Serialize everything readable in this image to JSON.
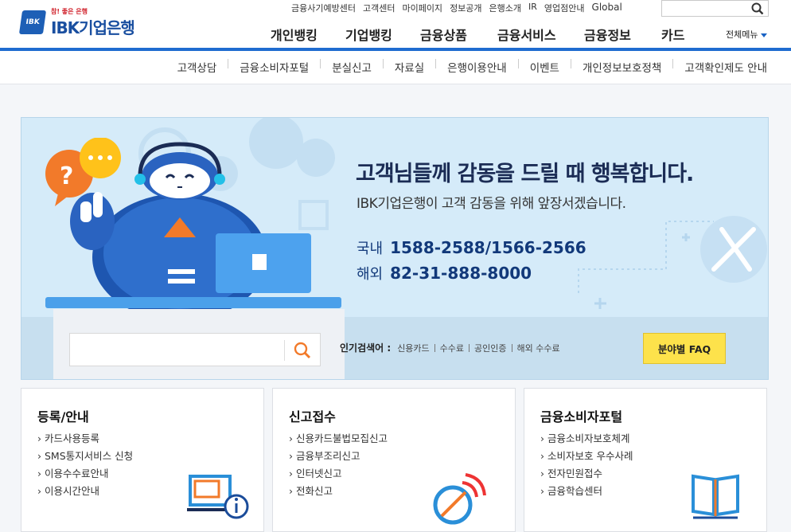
{
  "header": {
    "logo_tagline": "참! 좋은 은행",
    "logo_name": "IBK기업은행",
    "logo_mark": "IBK",
    "utility_links": [
      "금융사기예방센터",
      "고객센터",
      "마이페이지",
      "정보공개",
      "은행소개",
      "IR",
      "영업점안내",
      "Global"
    ],
    "search_placeholder": "",
    "gnb": [
      "개인뱅킹",
      "기업뱅킹",
      "금융상품",
      "금융서비스",
      "금융정보",
      "카드"
    ],
    "all_menu": "전체메뉴"
  },
  "subnav": [
    "고객상담",
    "금융소비자포털",
    "분실신고",
    "자료실",
    "은행이용안내",
    "이벤트",
    "개인정보보호정책",
    "고객확인제도 안내"
  ],
  "hero": {
    "title": "고객님들께 감동을 드릴 때 행복합니다.",
    "subtitle": "IBK기업은행이 고객 감동을 위해 앞장서겠습니다.",
    "domestic_label": "국내",
    "domestic_phone": "1588-2588/1566-2566",
    "overseas_label": "해외",
    "overseas_phone": "82-31-888-8000",
    "search_placeholder": "",
    "popular_title": "인기검색어 :",
    "popular_keywords": [
      "신용카드",
      "수수료",
      "공인인증",
      "해외 수수료"
    ],
    "faq_button": "분야별 FAQ"
  },
  "cards": [
    {
      "title": "등록/안내",
      "items": [
        "카드사용등록",
        "SMS통지서비스 신청",
        "이용수수료안내",
        "이용시간안내"
      ],
      "icon": "monitor-info-icon"
    },
    {
      "title": "신고접수",
      "items": [
        "신용카드불법모집신고",
        "금융부조리신고",
        "인터넷신고",
        "전화신고"
      ],
      "icon": "satellite-dish-icon"
    },
    {
      "title": "금융소비자포털",
      "items": [
        "금융소비자보호체계",
        "소비자보호 우수사례",
        "전자민원접수",
        "금융학습센터"
      ],
      "icon": "open-book-icon"
    }
  ],
  "colors": {
    "brand_blue": "#1f6cd0",
    "faq_yellow": "#fde24b",
    "hero_bg": "#d5ebf9"
  }
}
